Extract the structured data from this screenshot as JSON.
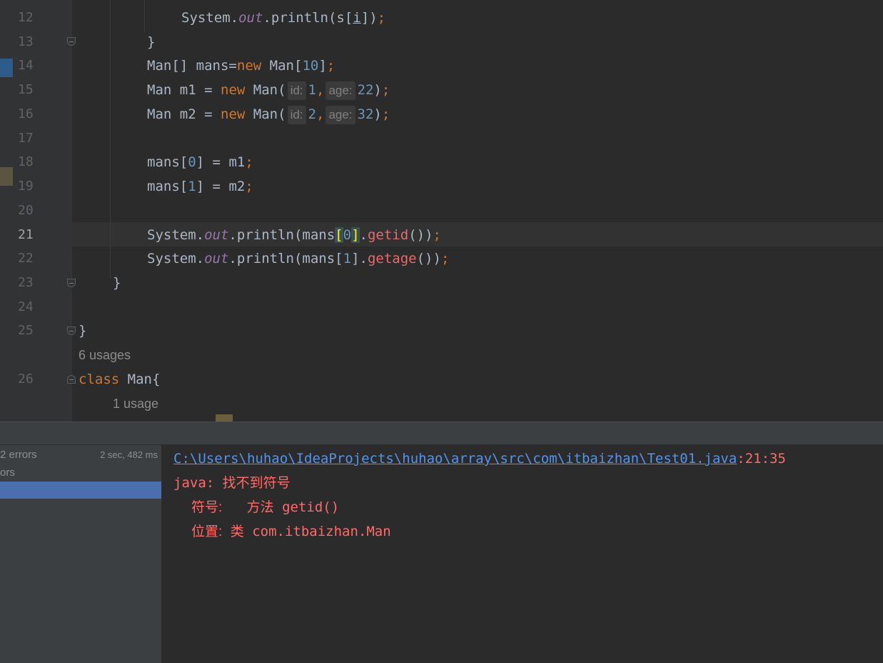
{
  "editor": {
    "lines": [
      {
        "n": "12",
        "text": "System.out.println(s[i]);"
      },
      {
        "n": "13",
        "text": "}"
      },
      {
        "n": "14",
        "text": "Man[] mans=new Man[10];"
      },
      {
        "n": "15",
        "text": "Man m1 = new Man( id: 1, age: 22);"
      },
      {
        "n": "16",
        "text": "Man m2 = new Man( id: 2, age: 32);"
      },
      {
        "n": "17",
        "text": ""
      },
      {
        "n": "18",
        "text": "mans[0] = m1;"
      },
      {
        "n": "19",
        "text": "mans[1] = m2;"
      },
      {
        "n": "20",
        "text": ""
      },
      {
        "n": "21",
        "text": "System.out.println(mans[0].getid());"
      },
      {
        "n": "22",
        "text": "System.out.println(mans[1].getage());"
      },
      {
        "n": "23",
        "text": "}"
      },
      {
        "n": "24",
        "text": ""
      },
      {
        "n": "25",
        "text": "}"
      },
      {
        "n": "26",
        "text": "class Man{"
      }
    ],
    "tokens": {
      "system": "System",
      "out": "out",
      "println": "println",
      "s": "s",
      "i": "i",
      "man": "Man",
      "mans": "mans",
      "new": "new",
      "ten": "10",
      "m1": "m1",
      "m2": "m2",
      "hint_id": "id:",
      "hint_age": "age:",
      "v1": "1",
      "v22": "22",
      "v2": "2",
      "v32": "32",
      "zero": "0",
      "one": "1",
      "getid": "getid",
      "getage": "getage",
      "class_kw": "class",
      "brace_open": "{",
      "brace_close": "}"
    },
    "usages": {
      "class_usages": "6 usages",
      "member_usages": "1 usage"
    },
    "active_line": "21"
  },
  "build_tree": {
    "rows": [
      {
        "label": "2 errors",
        "time": "2 sec, 482 ms"
      },
      {
        "label": "ors",
        "time": ""
      },
      {
        "label": "",
        "time": ""
      }
    ]
  },
  "output": {
    "path_link": "C:\\Users\\huhao\\IdeaProjects\\huhao\\array\\src\\com\\itbaizhan\\Test01.java",
    "position": ":21:35",
    "error_prefix": "java: ",
    "error_msg": "找不到符号",
    "symbol_label": "符号:",
    "symbol_kind": "方法",
    "symbol_name": "getid()",
    "location_label": "位置:",
    "location_kind": "类",
    "location_name": "com.itbaizhan.Man"
  },
  "colors": {
    "keyword": "#cc7832",
    "number": "#6897bb",
    "field": "#9876aa",
    "error": "#ff6b68",
    "link": "#5394ec",
    "selection": "#4b6eaf"
  }
}
